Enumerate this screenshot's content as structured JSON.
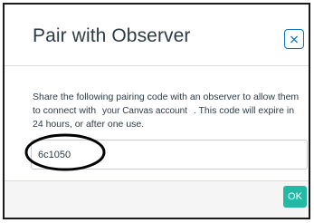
{
  "dialog": {
    "title": "Pair with Observer",
    "close_label": "close",
    "text_before": "Share the following pairing code with an observer to allow them to connect with ",
    "account_phrase": "your Canvas account",
    "text_after": " . This code will expire in 24 hours, or after one use.",
    "pairing_code": "6c1050",
    "ok_label": "OK"
  },
  "colors": {
    "accent": "#0b73bf",
    "ok_button": "#23b9a4",
    "annotation_circle": "#000000"
  }
}
